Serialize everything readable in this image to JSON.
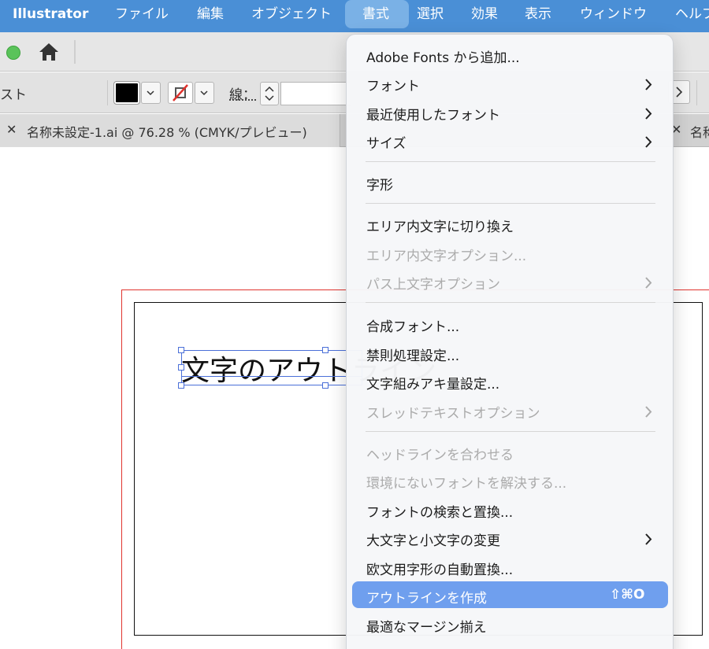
{
  "menubar": {
    "app_name": "Illustrator",
    "items": [
      "ファイル",
      "編集",
      "オブジェクト",
      "書式",
      "選択",
      "効果",
      "表示",
      "ウィンドウ",
      "ヘルプ"
    ]
  },
  "controlbar": {
    "left_text": "スト",
    "stroke_label": "線："
  },
  "tabs": {
    "active_title": "名称未設定-1.ai @ 76.28 % (CMYK/プレビュー)",
    "second_title": "名称"
  },
  "canvas": {
    "text_object": "文字のアウトライン"
  },
  "type_menu": {
    "items": [
      {
        "label": "Adobe Fonts から追加...",
        "enabled": true,
        "submenu": false
      },
      {
        "label": "フォント",
        "enabled": true,
        "submenu": true
      },
      {
        "label": "最近使用したフォント",
        "enabled": true,
        "submenu": true
      },
      {
        "label": "サイズ",
        "enabled": true,
        "submenu": true
      },
      {
        "label": "字形",
        "enabled": true,
        "submenu": false
      },
      {
        "label": "エリア内文字に切り換え",
        "enabled": true,
        "submenu": false
      },
      {
        "label": "エリア内文字オプション...",
        "enabled": false,
        "submenu": false
      },
      {
        "label": "パス上文字オプション",
        "enabled": false,
        "submenu": true
      },
      {
        "label": "合成フォント...",
        "enabled": true,
        "submenu": false
      },
      {
        "label": "禁則処理設定...",
        "enabled": true,
        "submenu": false
      },
      {
        "label": "文字組みアキ量設定...",
        "enabled": true,
        "submenu": false
      },
      {
        "label": "スレッドテキストオプション",
        "enabled": false,
        "submenu": true
      },
      {
        "label": "ヘッドラインを合わせる",
        "enabled": false,
        "submenu": false
      },
      {
        "label": "環境にないフォントを解決する...",
        "enabled": false,
        "submenu": false
      },
      {
        "label": "フォントの検索と置換...",
        "enabled": true,
        "submenu": false
      },
      {
        "label": "大文字と小文字の変更",
        "enabled": true,
        "submenu": true
      },
      {
        "label": "欧文用字形の自動置換...",
        "enabled": true,
        "submenu": false
      },
      {
        "label": "アウトラインを作成",
        "enabled": true,
        "submenu": false,
        "highlighted": true,
        "shortcut": "⇧⌘O"
      },
      {
        "label": "最適なマージン揃え",
        "enabled": true,
        "submenu": false
      }
    ]
  },
  "colors": {
    "menubar_bg": "#4a8fd6",
    "menu_highlight": "#6f9fee",
    "bleed_line": "#e0332e",
    "selection": "#4a6fd8"
  }
}
